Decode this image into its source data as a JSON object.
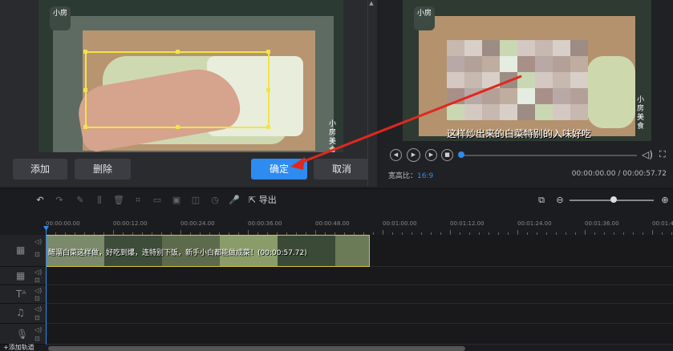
{
  "editor": {
    "add_button": "添加",
    "delete_button": "删除",
    "confirm_button": "确定",
    "cancel_button": "取消",
    "logo_text": "小房",
    "side_text": "小房美食"
  },
  "preview": {
    "subtitle": "这样炒出来的白菜特别的入味好吃",
    "aspect_label": "宽高比：",
    "aspect_value": "16:9",
    "timecode": "00:00:00.00 / 00:00:57.72"
  },
  "toolbar": {
    "export_label": "导出"
  },
  "ruler": {
    "labels": [
      "00:00:00.00",
      "00:00:12.00",
      "00:00:24.00",
      "00:00:36.00",
      "00:00:48.00",
      "00:01:00.00",
      "00:01:12.00",
      "00:01:24.00",
      "00:01:36.00",
      "00:01:48.00"
    ]
  },
  "timeline": {
    "clip_text": "醋溜白菜这样做，好吃到爆，连特别下饭，新手小白都能做成菜！(00:00:57.72)"
  },
  "bottom": {
    "add_track": "+添加轨道"
  },
  "colors": {
    "accent": "#2e8bf0",
    "selection": "#f1e34b",
    "arrow": "#e0281e"
  }
}
